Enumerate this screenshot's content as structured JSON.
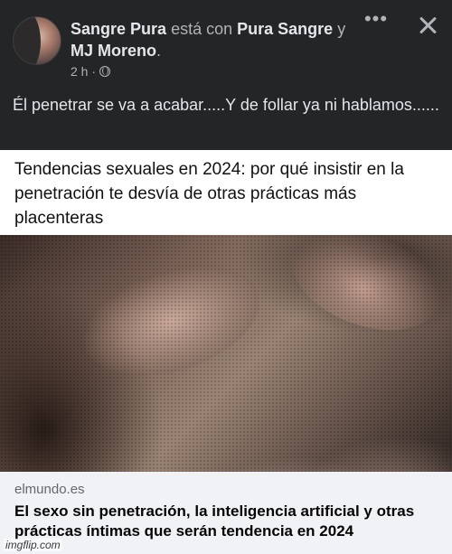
{
  "post": {
    "author": "Sangre Pura",
    "connector": "está con",
    "tagged_1": "Pura Sangre",
    "and_word": "y",
    "tagged_2": "MJ Moreno",
    "period": ".",
    "time": "2 h ·",
    "privacy_icon": "globe-icon",
    "more_icon": "•••",
    "close_icon": "close-icon",
    "text": "Él penetrar se va a acabar.....Y de follar ya ni hablamos......"
  },
  "article": {
    "headline": "Tendencias sexuales en 2024: por qué insistir en la penetración te desvía de otras prácticas más placenteras",
    "domain": "elmundo.es",
    "title": "El sexo sin penetración, la inteligencia artificial y otras prácticas íntimas que serán tendencia en 2024"
  },
  "watermark": "imgflip.com"
}
